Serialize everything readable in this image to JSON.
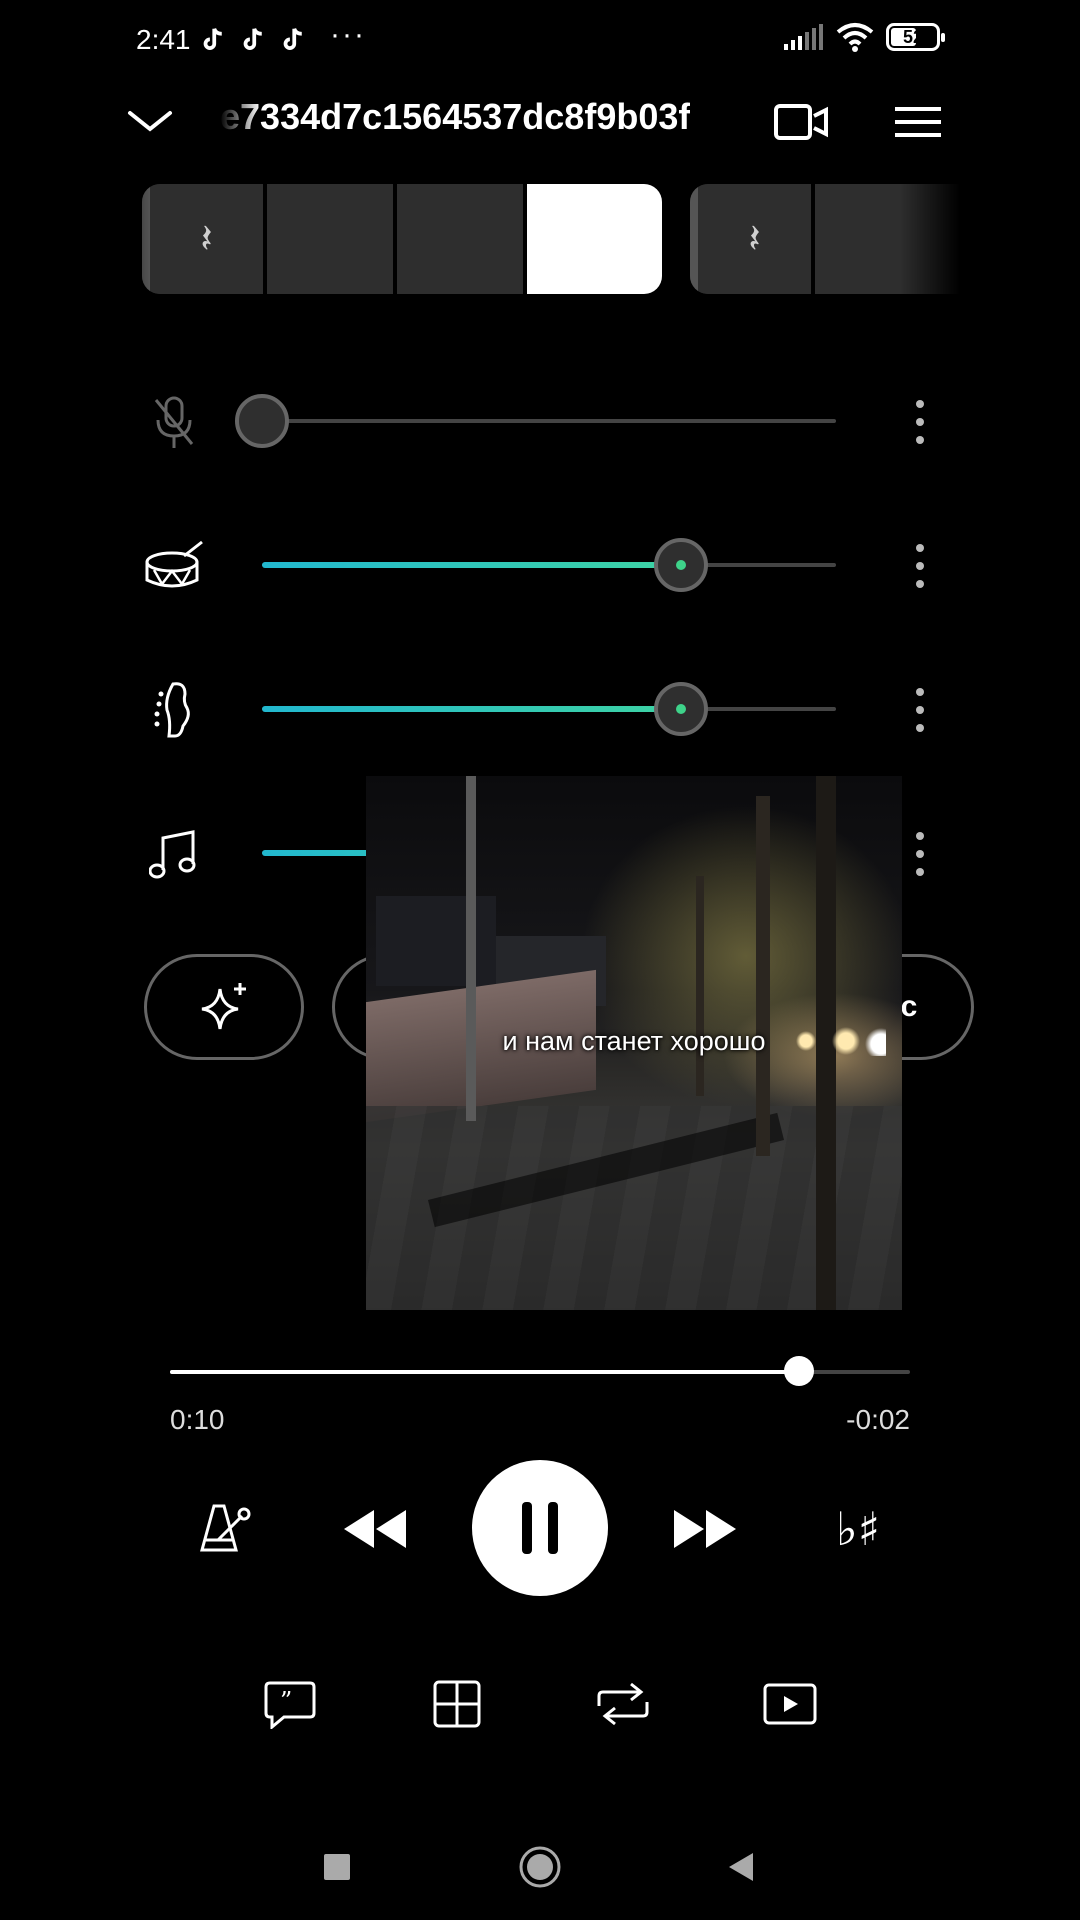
{
  "status": {
    "time": "2:41",
    "notifications": [
      "tiktok-icon",
      "tiktok-icon",
      "tiktok-icon"
    ],
    "more": "···",
    "battery": "52",
    "icons": [
      "signal-icon",
      "wifi-icon",
      "battery-icon"
    ]
  },
  "header": {
    "title": "e7334d7c1564537dc8f9b03f",
    "icons": [
      "chevron-down-icon",
      "screen-mirror-icon",
      "menu-icon"
    ]
  },
  "sections": {
    "group1": [
      "rest",
      "",
      "",
      ""
    ],
    "group2": [
      "rest",
      ""
    ],
    "active_index": 3,
    "rest_glyph": "𝄽"
  },
  "mixer": {
    "tracks": [
      {
        "name": "vocals",
        "icon": "mic-muted-icon",
        "level": 0.0,
        "muted": true
      },
      {
        "name": "drums",
        "icon": "drum-icon",
        "level": 0.73,
        "muted": false
      },
      {
        "name": "bass",
        "icon": "bass-guitar-icon",
        "level": 0.73,
        "muted": false
      },
      {
        "name": "other",
        "icon": "music-note-icon",
        "level": 0.73,
        "muted": false
      }
    ],
    "accent_color": "#3ed3a3"
  },
  "pills": {
    "ai_icon": "sparkle-icon",
    "right_label": "c"
  },
  "video": {
    "caption": "и нам станет хорошо"
  },
  "playback": {
    "progress": 0.85,
    "elapsed": "0:10",
    "remaining": "-0:02"
  },
  "controls": {
    "transpose_label": "♭♯",
    "icons": [
      "metronome-icon",
      "rewind-icon",
      "pause-icon",
      "fast-forward-icon"
    ]
  },
  "tools": [
    "lyrics-icon",
    "grid-icon",
    "loop-icon",
    "video-icon"
  ],
  "nav": [
    "square-icon",
    "home-icon",
    "back-icon"
  ]
}
